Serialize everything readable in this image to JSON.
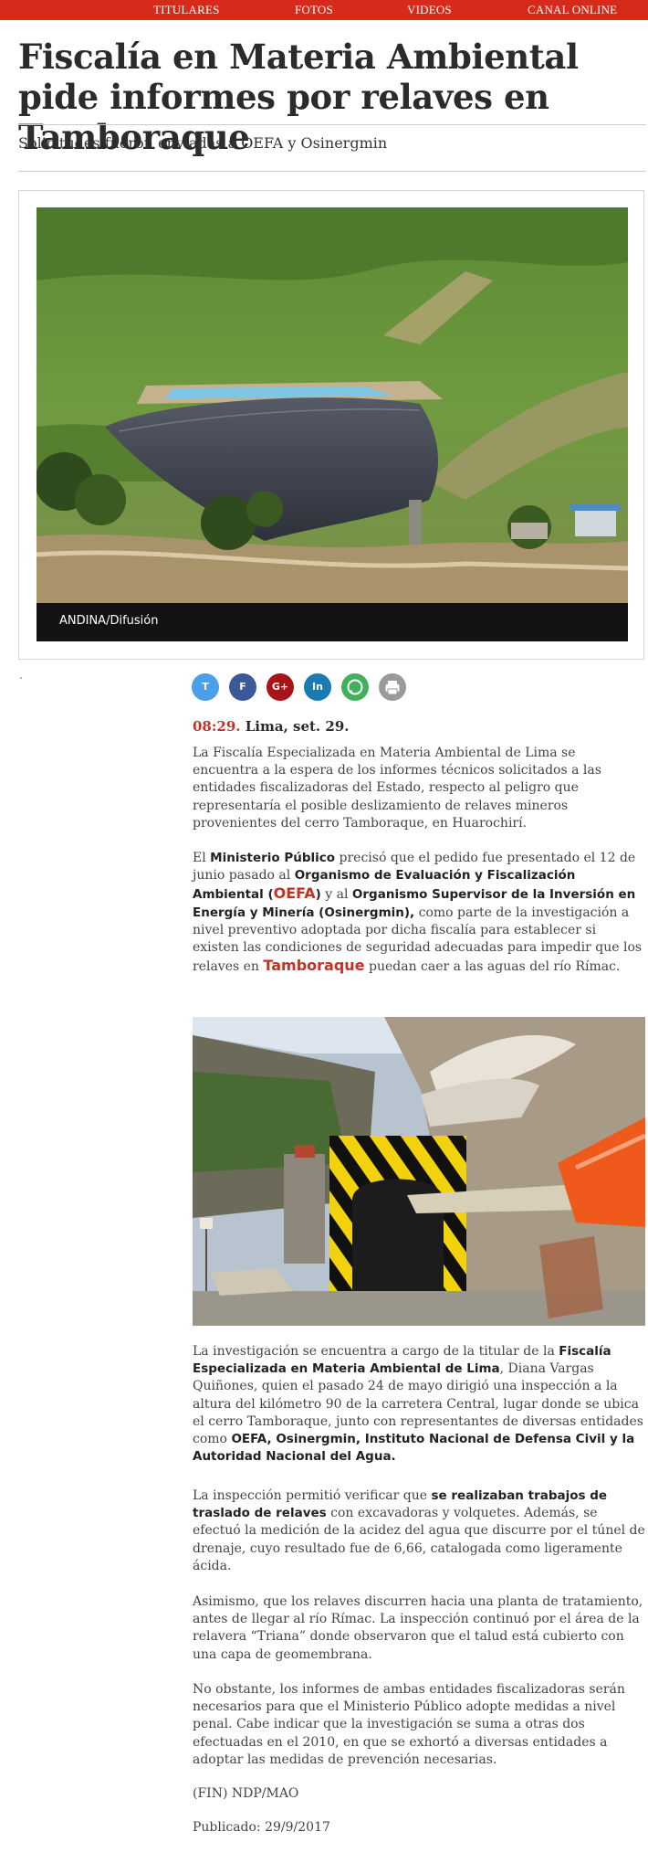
{
  "nav": {
    "items": [
      "TITULARES",
      "FOTOS",
      "VIDEOS",
      "CANAL ONLINE"
    ]
  },
  "article": {
    "headline": "Fiscalía en Materia Ambiental pide informes por relaves en Tamboraque",
    "subtitle": "Solicitudes fueron enviadas a OEFA y Osinergmin",
    "hero_caption": "ANDINA/Difusión",
    "dateline_time": "08:29.",
    "dateline_place": " Lima, set. 29.",
    "p1": "La Fiscalía Especializada en Materia Ambiental de Lima se encuentra a la espera de los informes técnicos solicitados a las entidades fiscalizadoras del Estado, respecto al peligro que representaría el posible deslizamiento de relaves mineros provenientes del cerro Tamboraque, en Huarochirí.",
    "p2": {
      "t1": "El ",
      "b1": "Ministerio Público",
      "t2": " precisó que el pedido fue presentado el 12 de junio pasado al ",
      "b2": "Organismo de Evaluación y Fiscalización Ambiental (",
      "kw1": "OEFA",
      "b3": ")",
      "t3": " y al ",
      "b4": "Organismo Supervisor de la Inversión en Energía y Minería (Osinergmin),",
      "t4": " como parte de la investigación a nivel preventivo adoptada por dicha fiscalía para establecer si existen las condiciones de seguridad adecuadas para impedir que los relaves en ",
      "kw2": "Tamboraque",
      "t5": " puedan caer a las aguas del río Rímac."
    },
    "p3": {
      "t1": "La investigación se encuentra a cargo de la titular de la ",
      "b1": "Fiscalía Especializada en Materia Ambiental de Lima",
      "t2": ", Diana Vargas Quiñones, quien el pasado 24 de mayo dirigió una inspección a la altura del kilómetro 90 de la carretera Central, lugar donde se ubica el cerro Tamboraque, junto con representantes de diversas entidades como ",
      "b2": "OEFA, Osinergmin, Instituto Nacional de Defensa Civil y la Autoridad Nacional del Agua."
    },
    "p4": {
      "t1": "La inspección permitió verificar que ",
      "b1": "se realizaban trabajos de traslado de relaves",
      "t2": " con excavadoras y volquetes. Además, se efectuó la medición de la acidez del agua que discurre por el túnel de drenaje, cuyo resultado fue de 6,66, catalogada como ligeramente ácida."
    },
    "p5": "Asimismo, que los relaves discurren hacia una planta de tratamiento, antes de llegar al río Rímac. La inspección continuó por el área de la relavera “Triana” donde observaron que el talud está cubierto con una capa de geomembrana.",
    "p6": "No obstante, los informes de ambas entidades fiscalizadoras serán necesarios para que el Ministerio Público adopte medidas a nivel penal. Cabe indicar que la investigación se suma a otras dos efectuadas en el 2010, en que se exhortó a diversas entidades a adoptar las medidas de prevención necesarias.",
    "signature": "(FIN) NDP/MAO",
    "published": "Publicado: 29/9/2017"
  },
  "share": {
    "twitter": "T",
    "facebook": "F",
    "googleplus": "G+",
    "linkedin": "In"
  },
  "colors": {
    "nav_bg": "#d62a1a",
    "accent": "#c23324"
  }
}
